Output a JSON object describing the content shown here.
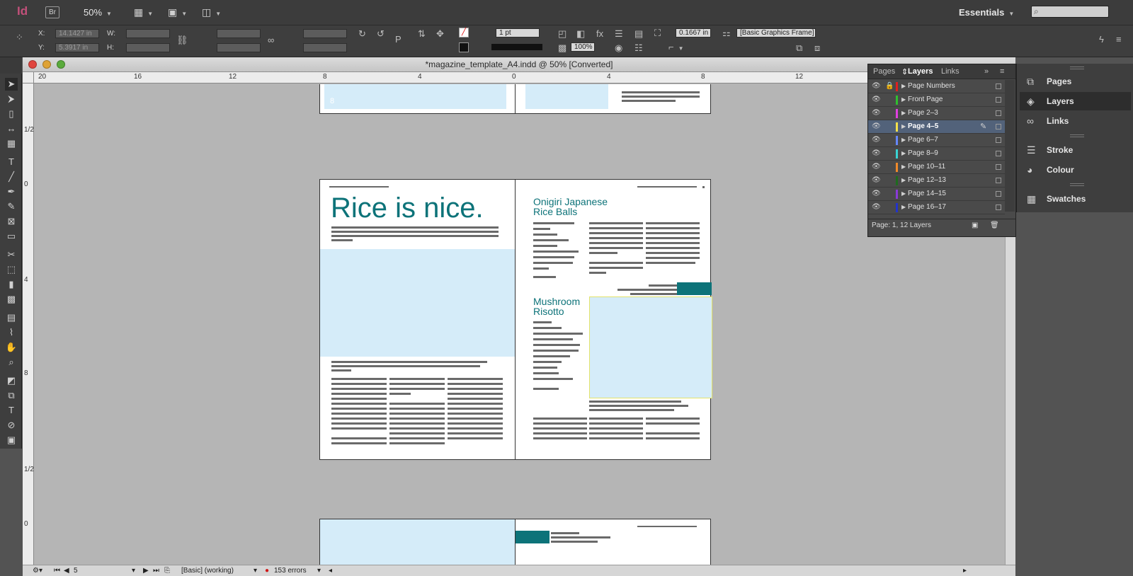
{
  "app": {
    "logo": "Id",
    "bridge": "Br",
    "zoom": "50%",
    "workspace": "Essentials",
    "search_placeholder": ""
  },
  "control_panel": {
    "x_label": "X:",
    "y_label": "Y:",
    "w_label": "W:",
    "h_label": "H:",
    "x_value": "14.1427 in",
    "y_value": "5.3917 in",
    "stroke_weight": "1 pt",
    "opacity": "100%",
    "fitting_value": "0.1667 in",
    "object_style": "[Basic Graphics Frame]"
  },
  "document": {
    "title": "*magazine_template_A4.indd @ 50% [Converted]",
    "hruler_ticks": [
      "20",
      "16",
      "12",
      "8",
      "4",
      "0",
      "4",
      "8",
      "12"
    ],
    "vruler_ticks": [
      "1/2",
      "0",
      "4",
      "8",
      "1/2",
      "0"
    ]
  },
  "spread_top": {
    "page_number": "8"
  },
  "spread_main": {
    "left_headline": "Rice is nice.",
    "right_headline_1_line1": "Onigiri Japanese",
    "right_headline_1_line2": "Rice Balls",
    "right_headline_2_line1": "Mushroom",
    "right_headline_2_line2": "Risotto"
  },
  "status": {
    "page": "5",
    "preflight_profile": "[Basic] (working)",
    "errors": "153 errors"
  },
  "layers_panel": {
    "tabs": [
      "Pages",
      "Layers",
      "Links"
    ],
    "active_tab": "Layers",
    "layers": [
      {
        "name": "Page Numbers",
        "color": "#e02020",
        "locked": true
      },
      {
        "name": "Front Page",
        "color": "#2fbf2f",
        "locked": false
      },
      {
        "name": "Page 2–3",
        "color": "#e040e0",
        "locked": false
      },
      {
        "name": "Page 4–5",
        "color": "#f4e04a",
        "locked": false,
        "selected": true
      },
      {
        "name": "Page 6–7",
        "color": "#6688ff",
        "locked": false
      },
      {
        "name": "Page 8–9",
        "color": "#39d4d4",
        "locked": false
      },
      {
        "name": "Page 10–11",
        "color": "#f08a2a",
        "locked": false
      },
      {
        "name": "Page 12–13",
        "color": "#1e6b1e",
        "locked": false
      },
      {
        "name": "Page 14–15",
        "color": "#8a3ad8",
        "locked": false
      },
      {
        "name": "Page 16–17",
        "color": "#2233cc",
        "locked": false
      }
    ],
    "footer": "Page: 1, 12 Layers"
  },
  "dock": {
    "items": [
      "Pages",
      "Layers",
      "Links",
      "Stroke",
      "Colour",
      "Swatches"
    ]
  }
}
